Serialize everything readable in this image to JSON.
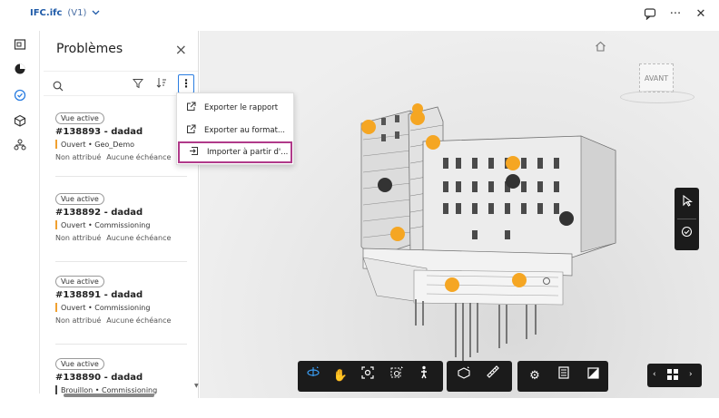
{
  "topbar": {
    "file_name": "IFC.ifc",
    "version": "(V1)",
    "chevron_icon": "chevron-down-icon",
    "right_icons": [
      "chat-icon",
      "more-icon",
      "close-icon"
    ]
  },
  "rail": {
    "icons": [
      "views-icon",
      "layers-icon",
      "issues-icon",
      "model-icon",
      "tree-icon"
    ],
    "active": "issues-icon"
  },
  "panel": {
    "title": "Problèmes",
    "close": "×",
    "issues": [
      {
        "badge": "Vue active",
        "id": "#138893 - dadad",
        "status": "Ouvert • Geo_Demo",
        "status_color": "#f0a030",
        "assignee": "Non attribué",
        "due": "Aucune échéance"
      },
      {
        "badge": "Vue active",
        "id": "#138892 - dadad",
        "status": "Ouvert • Commissioning",
        "status_color": "#f0a030",
        "assignee": "Non attribué",
        "due": "Aucune échéance"
      },
      {
        "badge": "Vue active",
        "id": "#138891 - dadad",
        "status": "Ouvert • Commissioning",
        "status_color": "#f0a030",
        "assignee": "Non attribué",
        "due": "Aucune échéance"
      },
      {
        "badge": "Vue active",
        "id": "#138890 - dadad",
        "status": "Brouillon • Commissioning",
        "status_color": "#444444",
        "assignee": "",
        "due": ""
      }
    ]
  },
  "menu": {
    "items": [
      {
        "label": "Exporter le rapport",
        "icon": "export-icon"
      },
      {
        "label": "Exporter au format...",
        "icon": "export-icon"
      },
      {
        "label": "Importer à partir d'...",
        "icon": "import-icon",
        "highlighted": true
      }
    ]
  },
  "viewer": {
    "cube_label": "AVANT",
    "pins": {
      "open_color": "#f5a623",
      "closed_color": "#333333"
    },
    "bottom_tools": [
      "orbit-icon",
      "pan-icon",
      "fit-icon",
      "zoom-window-icon",
      "walk-icon",
      "section-icon",
      "measure-icon",
      "settings-icon",
      "properties-icon",
      "fullscreen-icon"
    ],
    "side_tools": [
      "select-icon",
      "issue-add-icon"
    ]
  }
}
